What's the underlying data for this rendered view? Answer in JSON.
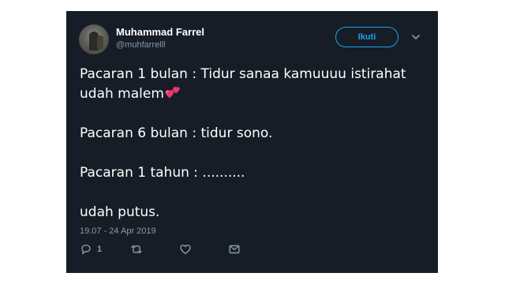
{
  "tweet": {
    "display_name": "Muhammad Farrel",
    "handle": "@muhfarrelll",
    "follow_label": "Ikuti",
    "lines": [
      "Pacaran 1 bulan : Tidur sanaa kamuuuu istirahat udah malem",
      "Pacaran 6 bulan : tidur sono.",
      "Pacaran 1 tahun : ..........",
      "udah putus."
    ],
    "timestamp": "19.07 - 24 Apr 2019",
    "reply_count": "1"
  },
  "icons": {
    "emoji": "two-hearts-icon",
    "caret": "chevron-down-icon",
    "reply": "reply-icon",
    "retweet": "retweet-icon",
    "like": "heart-icon",
    "dm": "envelope-icon"
  },
  "colors": {
    "background": "#161d26",
    "accent": "#1da1f2",
    "muted": "#8899a6",
    "text": "#ffffff",
    "emoji": "#e8386a"
  }
}
